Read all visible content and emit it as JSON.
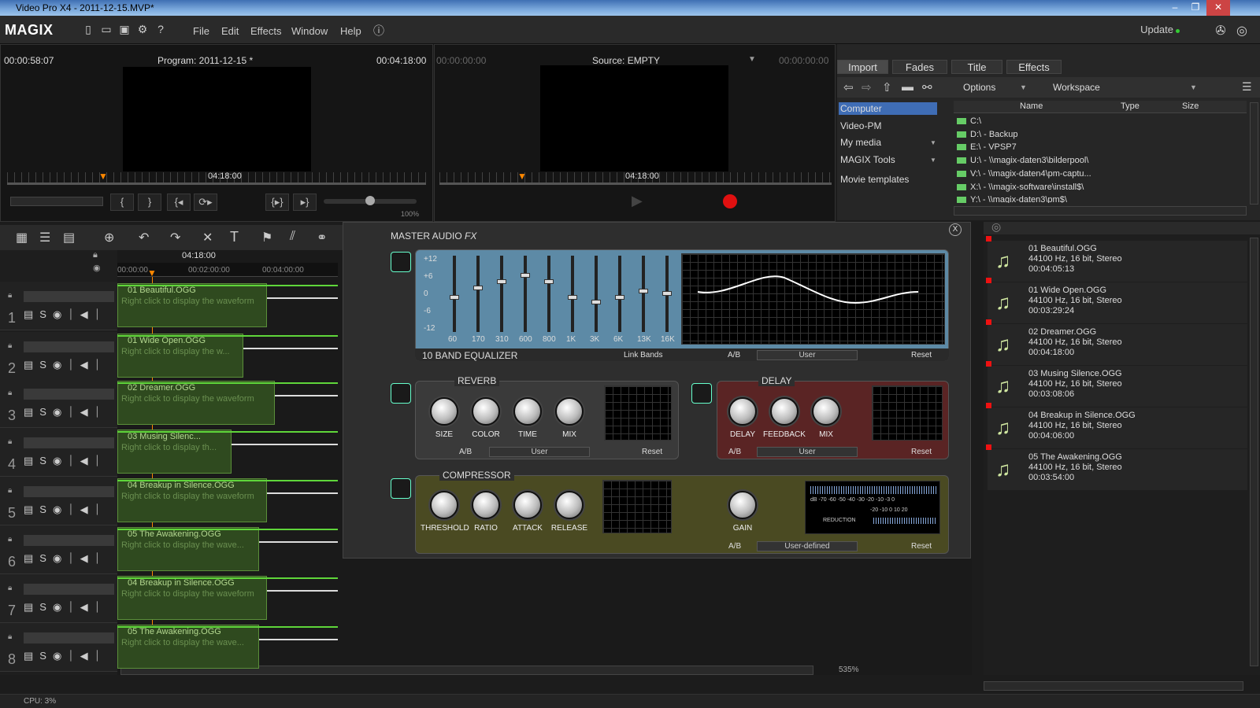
{
  "window": {
    "title": "Video Pro X4 - 2011-12-15.MVP*"
  },
  "menubar": {
    "logo": "MAGIX",
    "menus": [
      "File",
      "Edit",
      "Effects",
      "Window",
      "Help"
    ],
    "update_label": "Update"
  },
  "program_monitor": {
    "left_time": "00:00:58:07",
    "title": "Program: 2011-12-15 *",
    "right_time": "00:04:18:00",
    "ruler_time": "04:18:00",
    "zoom": "100%"
  },
  "source_monitor": {
    "left_time": "00:00:00:00",
    "title": "Source: EMPTY",
    "right_time": "00:00:00:00",
    "ruler_time": "04:18:00"
  },
  "browser": {
    "tabs": [
      "Import",
      "Fades",
      "Title",
      "Effects"
    ],
    "options_label": "Options",
    "workspace_label": "Workspace",
    "sidebar": [
      "Computer",
      "Video-PM",
      "My media",
      "MAGIX Tools",
      "Movie templates"
    ],
    "columns": [
      "Name",
      "Type",
      "Size"
    ],
    "drives": [
      "C:\\",
      "D:\\ - Backup",
      "E:\\ - VPSP7",
      "U:\\ - \\\\magix-daten3\\bilderpool\\",
      "V:\\ - \\\\magix-daten4\\pm-captu...",
      "X:\\ - \\\\magix-software\\install$\\",
      "Y:\\ - \\\\magix-daten3\\pm$\\"
    ]
  },
  "timeline": {
    "time_marker": "04:18:00",
    "ticks": [
      "00:00:00",
      "00:02:00:00",
      "00:04:00:00"
    ],
    "track_numbers": [
      "1",
      "2",
      "3",
      "4",
      "5",
      "6",
      "7",
      "8"
    ],
    "clips": [
      {
        "name": "01 Beautiful.OGG",
        "hint": "Right click to display the waveform"
      },
      {
        "name": "01 Wide Open.OGG",
        "hint": "Right click to display the w..."
      },
      {
        "name": "02 Dreamer.OGG",
        "hint": "Right click to display the waveform"
      },
      {
        "name": "03 Musing Silenc...",
        "hint": "Right click to display th..."
      },
      {
        "name": "04 Breakup in Silence.OGG",
        "hint": "Right click to display the waveform"
      },
      {
        "name": "05 The Awakening.OGG",
        "hint": "Right click to display the wave..."
      },
      {
        "name": "04 Breakup in Silence.OGG",
        "hint": "Right click to display the waveform"
      },
      {
        "name": "05 The Awakening.OGG",
        "hint": "Right click to display the wave..."
      }
    ],
    "zoom": "535%"
  },
  "master_fx": {
    "title": "MASTER AUDIO",
    "title_suffix": "FX",
    "close": "X",
    "eq": {
      "label": "10 BAND EQUALIZER",
      "link_bands": "Link Bands",
      "db_labels": [
        "+12",
        "+6",
        "0",
        "-6",
        "-12"
      ],
      "bands": [
        "60",
        "170",
        "310",
        "600",
        "800",
        "1K",
        "3K",
        "6K",
        "13K",
        "16K"
      ],
      "ab": "A/B",
      "preset": "User",
      "reset": "Reset"
    },
    "reverb": {
      "title": "REVERB",
      "knobs": [
        "SIZE",
        "COLOR",
        "TIME",
        "MIX"
      ],
      "ab": "A/B",
      "preset": "User",
      "reset": "Reset"
    },
    "delay": {
      "title": "DELAY",
      "knobs": [
        "DELAY",
        "FEEDBACK",
        "MIX"
      ],
      "ab": "A/B",
      "preset": "User",
      "reset": "Reset"
    },
    "compressor": {
      "title": "COMPRESSOR",
      "knobs": [
        "THRESHOLD",
        "RATIO",
        "ATTACK",
        "RELEASE"
      ],
      "gain": "GAIN",
      "meter_db": "dB -70 -60 -50 -40 -30 -20 -10 -3 0",
      "meter_low": "-20 -10 0 10 20",
      "reduction": "REDUCTION",
      "ab": "A/B",
      "preset": "User-defined",
      "reset": "Reset"
    }
  },
  "media_list": [
    {
      "name": "01 Beautiful.OGG",
      "info": "44100 Hz, 16 bit, Stereo",
      "duration": "00:04:05:13"
    },
    {
      "name": "01 Wide Open.OGG",
      "info": "44100 Hz, 16 bit, Stereo",
      "duration": "00:03:29:24"
    },
    {
      "name": "02 Dreamer.OGG",
      "info": "44100 Hz, 16 bit, Stereo",
      "duration": "00:04:18:00"
    },
    {
      "name": "03 Musing Silence.OGG",
      "info": "44100 Hz, 16 bit, Stereo",
      "duration": "00:03:08:06"
    },
    {
      "name": "04 Breakup in Silence.OGG",
      "info": "44100 Hz, 16 bit, Stereo",
      "duration": "00:04:06:00"
    },
    {
      "name": "05 The Awakening.OGG",
      "info": "44100 Hz, 16 bit, Stereo",
      "duration": "00:03:54:00"
    }
  ],
  "status": {
    "cpu": "CPU: 3%"
  },
  "colors": {
    "accent_green": "#5fd63a",
    "record_red": "#e01010",
    "browser_selected": "#3f6db5"
  }
}
